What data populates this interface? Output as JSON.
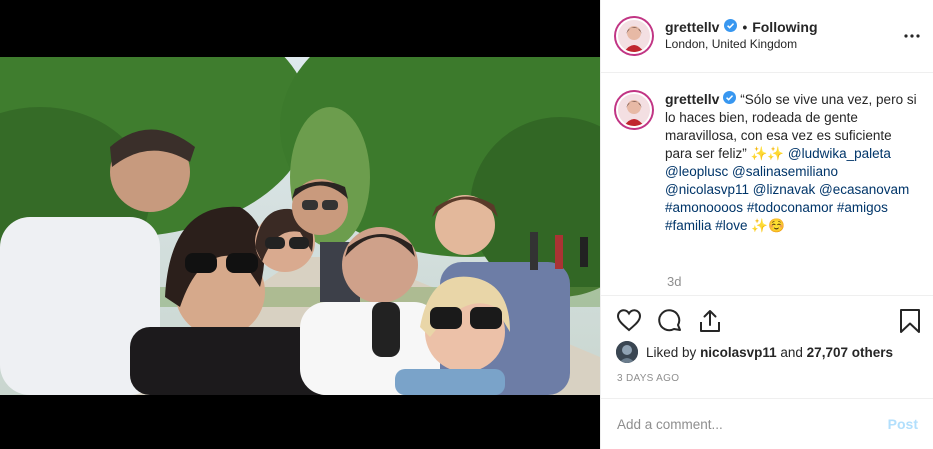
{
  "post": {
    "username": "grettellv",
    "follow_status": "Following",
    "location": "London, United Kingdom",
    "caption_quote": "“Sólo se vive una vez, pero si lo haces bien, rodeada de gente maravillosa, con esa vez es suficiente para ser feliz” ✨✨",
    "mentions": [
      "@ludwika_paleta",
      "@leoplusc",
      "@salinasemiliano",
      "@nicolasvp11",
      "@liznavak",
      "@ecasanovam"
    ],
    "hashtags": [
      "#amonoooos",
      "#todoconamor",
      "#amigos",
      "#familia",
      "#love"
    ],
    "caption_end": "✨☺️",
    "time_relative": "3d",
    "liked_by_prefix": "Liked by",
    "liked_by_user": "nicolasvp11",
    "liked_by_and": "and",
    "liked_by_others": "27,707 others",
    "time_ago": "3 DAYS AGO",
    "comment_placeholder": "Add a comment...",
    "post_button": "Post"
  },
  "icons": {
    "verified": "verified-badge-icon",
    "more": "more-options-icon",
    "like": "heart-icon",
    "comment": "comment-icon",
    "share": "share-icon",
    "save": "bookmark-icon"
  },
  "colors": {
    "link": "#003569",
    "verified": "#3897f0",
    "muted": "#8e8e8e",
    "post_button": "#b2dffc"
  }
}
